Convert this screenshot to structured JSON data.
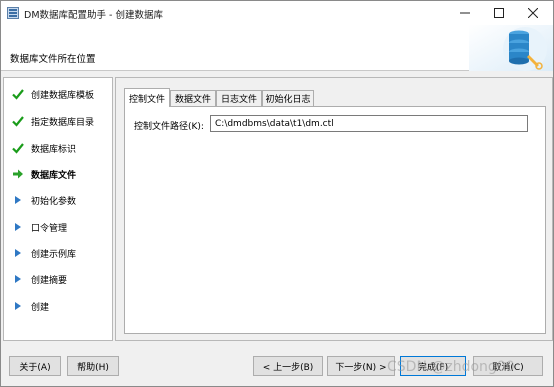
{
  "window": {
    "title": "DM数据库配置助手 - 创建数据库",
    "icon": "app-icon"
  },
  "header": {
    "description": "数据库文件所在位置",
    "art_icon": "database-settings-icon"
  },
  "nav": {
    "items": [
      {
        "label": "创建数据库模板",
        "state": "done",
        "icon": "check-icon"
      },
      {
        "label": "指定数据库目录",
        "state": "done",
        "icon": "check-icon"
      },
      {
        "label": "数据库标识",
        "state": "done",
        "icon": "check-icon"
      },
      {
        "label": "数据库文件",
        "state": "current",
        "icon": "arrow-right-icon"
      },
      {
        "label": "初始化参数",
        "state": "pending",
        "icon": "triangle-right-icon"
      },
      {
        "label": "口令管理",
        "state": "pending",
        "icon": "triangle-right-icon"
      },
      {
        "label": "创建示例库",
        "state": "pending",
        "icon": "triangle-right-icon"
      },
      {
        "label": "创建摘要",
        "state": "pending",
        "icon": "triangle-right-icon"
      },
      {
        "label": "创建",
        "state": "pending",
        "icon": "triangle-right-icon"
      }
    ]
  },
  "tabs": [
    {
      "label": "控制文件",
      "active": true
    },
    {
      "label": "数据文件",
      "active": false
    },
    {
      "label": "日志文件",
      "active": false
    },
    {
      "label": "初始化日志",
      "active": false
    }
  ],
  "control_file": {
    "path_label": "控制文件路径(K):",
    "path_value": "C:\\dmdbms\\data\\t1\\dm.ctl"
  },
  "buttons": {
    "about": "关于(A)",
    "help": "帮助(H)",
    "prev": "< 上一步(B)",
    "next": "下一步(N) >",
    "finish": "完成(F)",
    "cancel": "取消(C)"
  },
  "watermark": "CSDN @zhdong00",
  "colors": {
    "check": "#1a9c1a",
    "arrow": "#2aa12a",
    "triangle": "#2f78c4",
    "focus_border": "#0078d7"
  }
}
